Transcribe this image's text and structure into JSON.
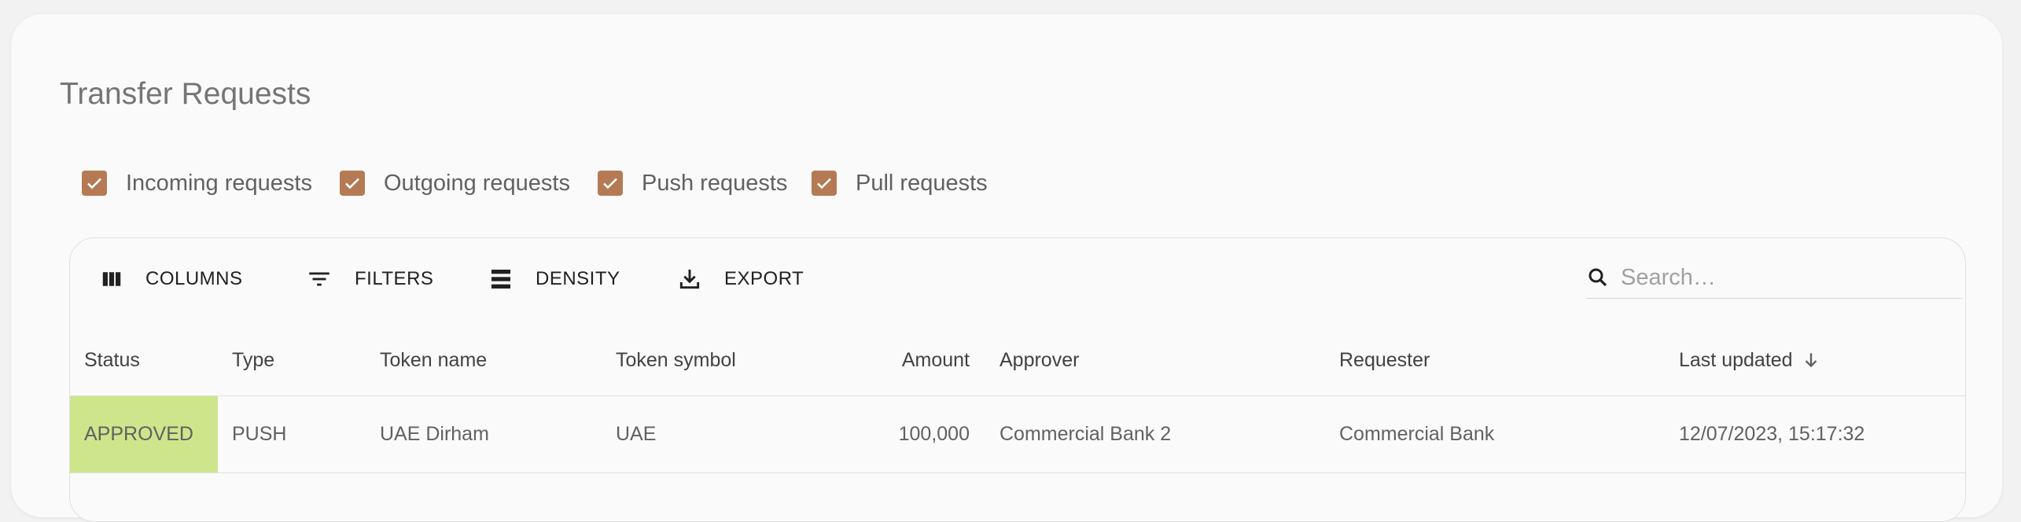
{
  "page": {
    "title": "Transfer Requests"
  },
  "filters": [
    {
      "label": "Incoming requests",
      "checked": true
    },
    {
      "label": "Outgoing requests",
      "checked": true
    },
    {
      "label": "Push requests",
      "checked": true
    },
    {
      "label": "Pull requests",
      "checked": true
    }
  ],
  "toolbar": {
    "columns_label": "COLUMNS",
    "filters_label": "FILTERS",
    "density_label": "DENSITY",
    "export_label": "EXPORT",
    "search_placeholder": "Search…"
  },
  "table": {
    "columns": [
      "Status",
      "Type",
      "Token name",
      "Token symbol",
      "Amount",
      "Approver",
      "Requester",
      "Last updated"
    ],
    "sort": {
      "column": "Last updated",
      "direction": "descending"
    },
    "rows": [
      {
        "status": "APPROVED",
        "type": "PUSH",
        "token_name": "UAE Dirham",
        "token_symbol": "UAE",
        "amount": "100,000",
        "approver": "Commercial Bank 2",
        "requester": "Commercial Bank",
        "last_updated": "12/07/2023, 15:17:32"
      }
    ]
  },
  "colors": {
    "checkbox": "#b57a54",
    "approved_status_bg": "#cde68b",
    "card_bg": "#fafafa",
    "text_primary": "#212121",
    "text_secondary": "#616161"
  },
  "icons": [
    "check-icon",
    "columns-icon",
    "filter-icon",
    "density-icon",
    "export-icon",
    "search-icon",
    "arrow-down-icon"
  ]
}
